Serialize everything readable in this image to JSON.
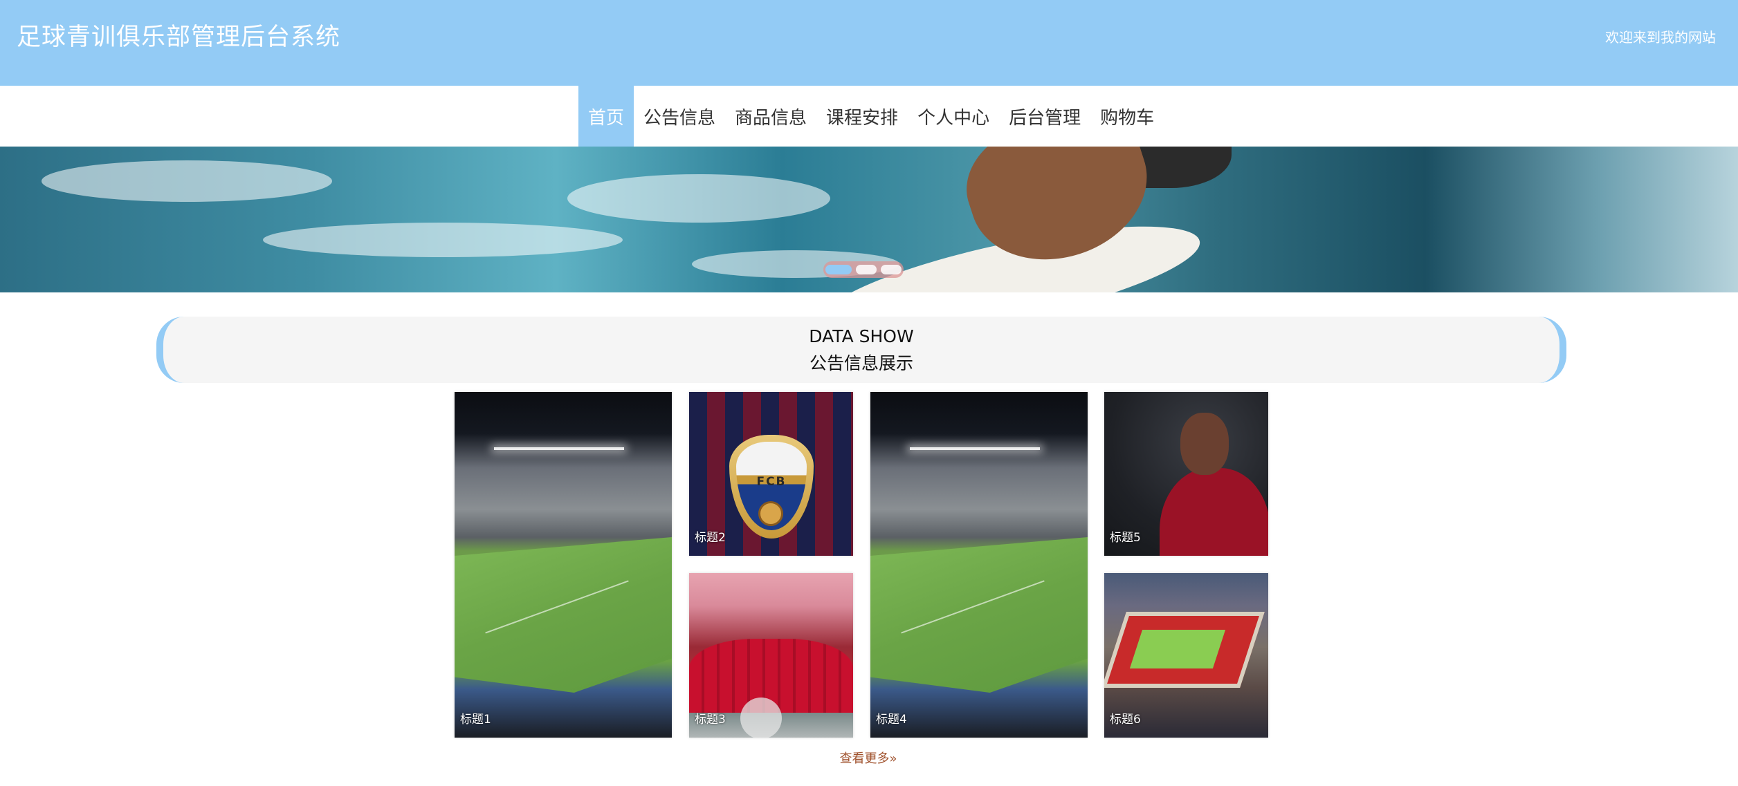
{
  "header": {
    "title": "足球青训俱乐部管理后台系统",
    "welcome": "欢迎来到我的网站"
  },
  "nav": {
    "items": [
      {
        "label": "首页",
        "active": true
      },
      {
        "label": "公告信息",
        "active": false
      },
      {
        "label": "商品信息",
        "active": false
      },
      {
        "label": "课程安排",
        "active": false
      },
      {
        "label": "个人中心",
        "active": false
      },
      {
        "label": "后台管理",
        "active": false
      },
      {
        "label": "购物车",
        "active": false
      }
    ]
  },
  "banner": {
    "slide_count": 3,
    "active_slide": 1
  },
  "section": {
    "title_en": "DATA SHOW",
    "title_cn": "公告信息展示"
  },
  "gallery": {
    "items": [
      {
        "caption": "标题1",
        "image": "stadium-night"
      },
      {
        "caption": "标题2",
        "image": "fcb-crest"
      },
      {
        "caption": "标题3",
        "image": "liverpool-celebration"
      },
      {
        "caption": "标题4",
        "image": "stadium-night"
      },
      {
        "caption": "标题5",
        "image": "player-portrait"
      },
      {
        "caption": "标题6",
        "image": "anfield-aerial"
      }
    ],
    "more_label": "查看更多»"
  },
  "colors": {
    "header_bg": "#93cbf5",
    "nav_active_bg": "#93cbf5",
    "more_link": "#a0522d"
  }
}
